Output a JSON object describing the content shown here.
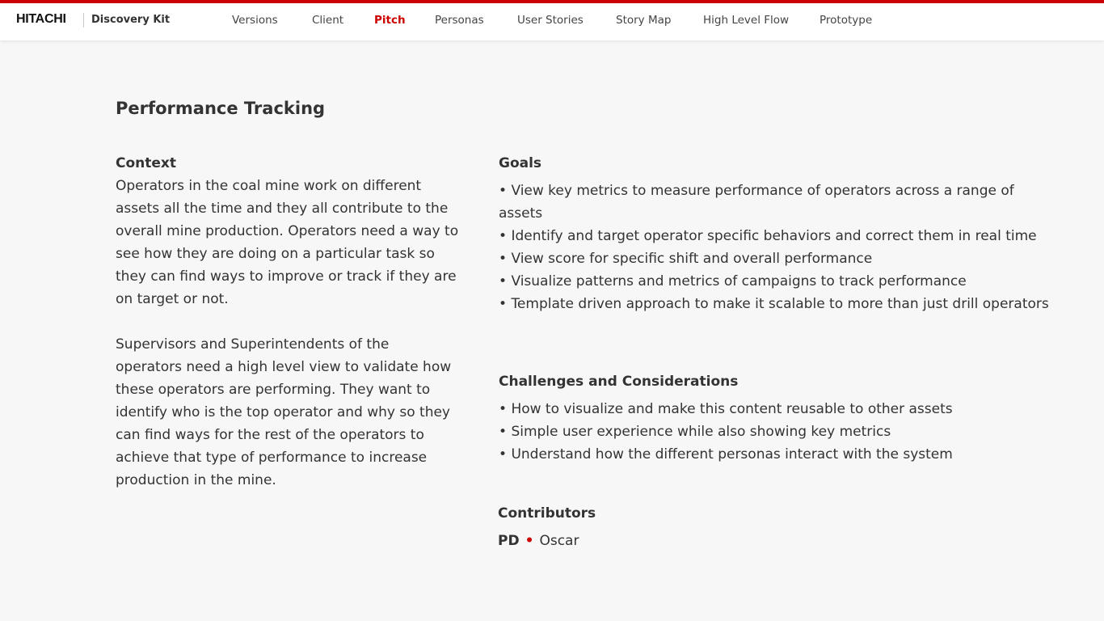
{
  "header": {
    "brand": "HITACHI",
    "product": "Discovery Kit",
    "tabs": [
      {
        "label": "Versions"
      },
      {
        "label": "Client"
      },
      {
        "label": "Pitch"
      },
      {
        "label": "Personas"
      },
      {
        "label": "User Stories"
      },
      {
        "label": "Story Map"
      },
      {
        "label": "High Level Flow"
      },
      {
        "label": "Prototype"
      }
    ],
    "active_tab": "Pitch",
    "accent_color": "#cc0000"
  },
  "page": {
    "title": "Performance Tracking",
    "context": {
      "heading": "Context",
      "paragraphs": [
        "Operators in the coal mine work on different assets all the time and they all contribute to the overall mine production. Operators need a way to see how they are doing on a particular task so they can find ways to improve or track if they are on target or not.",
        "Supervisors and Superintendents of the operators need a high level view to validate how these operators are performing. They want to identify who is the top operator and why so they can find ways for the rest of the operators to achieve that type of performance to increase production in the mine."
      ]
    },
    "goals": {
      "heading": "Goals",
      "items": [
        "View key metrics to measure performance of operators across a range of assets",
        "Identify and target operator specific behaviors and correct them in real time",
        "View score for specific shift and overall performance",
        "Visualize patterns and metrics of campaigns to track performance",
        "Template driven approach to make it scalable to more than just drill operators"
      ]
    },
    "challenges": {
      "heading": "Challenges and Considerations",
      "items": [
        "How to visualize and make this content reusable to other assets",
        "Simple user experience while also showing key metrics",
        "Understand how the different personas interact with the system"
      ]
    },
    "contributors": {
      "heading": "Contributors",
      "role": "PD",
      "separator": "•",
      "name": "Oscar"
    }
  }
}
